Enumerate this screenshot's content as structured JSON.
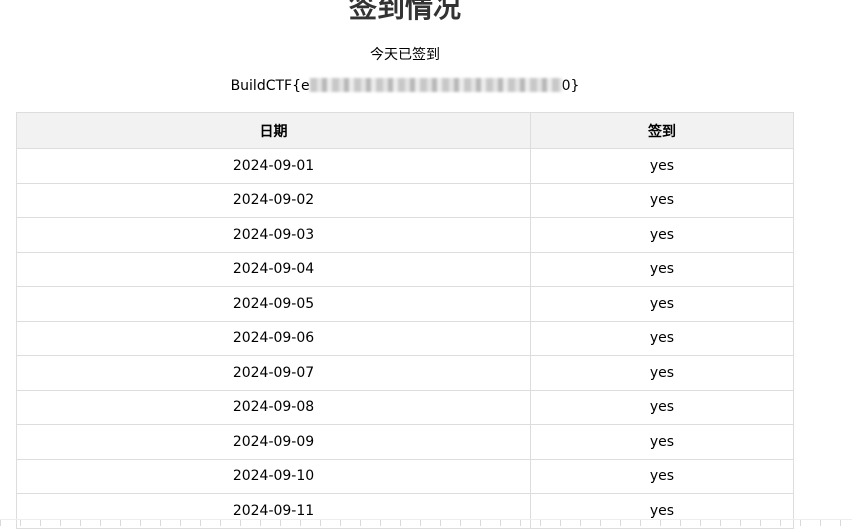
{
  "page": {
    "title": "签到情况",
    "status": "今天已签到",
    "flag_prefix": "BuildCTF{e",
    "flag_suffix": "0}"
  },
  "table": {
    "headers": {
      "date": "日期",
      "checkin": "签到"
    },
    "rows": [
      {
        "date": "2024-09-01",
        "checkin": "yes"
      },
      {
        "date": "2024-09-02",
        "checkin": "yes"
      },
      {
        "date": "2024-09-03",
        "checkin": "yes"
      },
      {
        "date": "2024-09-04",
        "checkin": "yes"
      },
      {
        "date": "2024-09-05",
        "checkin": "yes"
      },
      {
        "date": "2024-09-06",
        "checkin": "yes"
      },
      {
        "date": "2024-09-07",
        "checkin": "yes"
      },
      {
        "date": "2024-09-08",
        "checkin": "yes"
      },
      {
        "date": "2024-09-09",
        "checkin": "yes"
      },
      {
        "date": "2024-09-10",
        "checkin": "yes"
      },
      {
        "date": "2024-09-11",
        "checkin": "yes"
      }
    ]
  }
}
